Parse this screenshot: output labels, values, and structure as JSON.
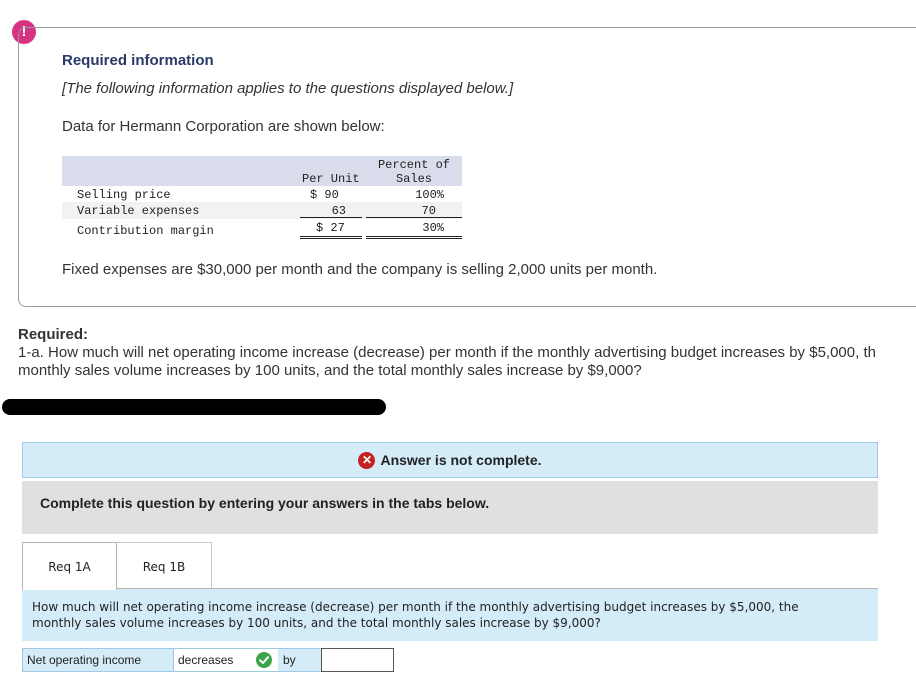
{
  "alert_icon": "!",
  "required_info": {
    "title": "Required information",
    "subtitle": "[The following information applies to the questions displayed below.]",
    "intro": "Data for Hermann Corporation are shown below:"
  },
  "table": {
    "headers": {
      "per_unit": "Per Unit",
      "percent_line1": "Percent of",
      "percent_line2": "Sales"
    },
    "rows": [
      {
        "label": "Selling price",
        "per_unit": "$ 90",
        "percent": "100%"
      },
      {
        "label": "Variable expenses",
        "per_unit": "63",
        "percent": "70"
      },
      {
        "label": "Contribution margin",
        "per_unit": "$ 27",
        "percent": "30%"
      }
    ]
  },
  "fixed_expenses_text": "Fixed expenses are $30,000 per month and the company is selling 2,000 units per month.",
  "required": {
    "label": "Required:",
    "question": "1-a. How much will net operating income increase (decrease) per month if the monthly advertising budget increases by $5,000, th\nmonthly sales volume increases by 100 units, and the total monthly sales increase by $9,000?"
  },
  "status": {
    "icon": "x-circle-icon",
    "text": "Answer is not complete."
  },
  "instruction": "Complete this question by entering your answers in the tabs below.",
  "tabs": [
    {
      "label": "Req 1A"
    },
    {
      "label": "Req 1B"
    }
  ],
  "question_panel": "How much will net operating income increase (decrease) per month if the monthly advertising budget increases by $5,000, the\nmonthly sales volume increases by 100 units, and the total monthly sales increase by $9,000?",
  "answer": {
    "label": "Net operating income",
    "direction": "decreases",
    "direction_status": "correct",
    "by_label": "by",
    "amount": ""
  },
  "colors": {
    "alert": "#d63384",
    "title": "#2a3a66",
    "panel_blue": "#d4ebf8",
    "error": "#c32323",
    "success": "#3aa54a"
  }
}
